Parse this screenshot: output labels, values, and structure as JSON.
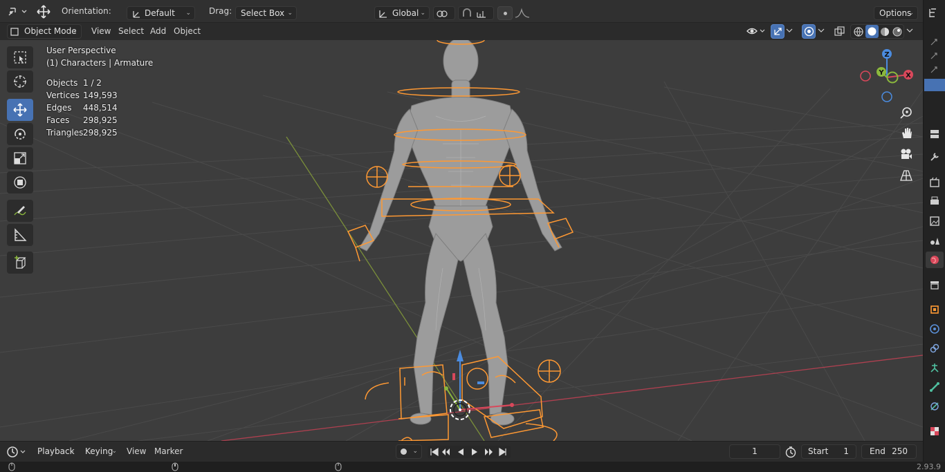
{
  "header": {
    "orientation_label": "Orientation:",
    "orientation_value": "Default",
    "drag_label": "Drag:",
    "drag_value": "Select Box",
    "transform_space": "Global",
    "options_label": "Options"
  },
  "viewport_header": {
    "mode": "Object Mode",
    "menus": [
      "View",
      "Select",
      "Add",
      "Object"
    ]
  },
  "overlay": {
    "perspective": "User Perspective",
    "collection": "(1) Characters | Armature",
    "stats": [
      {
        "label": "Objects",
        "value": "1 / 2"
      },
      {
        "label": "Vertices",
        "value": "149,593"
      },
      {
        "label": "Edges",
        "value": "448,514"
      },
      {
        "label": "Faces",
        "value": "298,925"
      },
      {
        "label": "Triangles",
        "value": "298,925"
      }
    ]
  },
  "gizmo": {
    "z": "Z",
    "y": "Y",
    "x": "X"
  },
  "timeline": {
    "menus": [
      "Playback",
      "Keying",
      "View",
      "Marker"
    ],
    "current_frame": "1",
    "start_label": "Start",
    "start_value": "1",
    "end_label": "End",
    "end_value": "250"
  },
  "status": {
    "version": "2.93.9"
  },
  "colors": {
    "accent": "#4772b3",
    "armature": "#ff9933",
    "x_axis": "#d9485b",
    "y_axis": "#8bb83d",
    "z_axis": "#4b8ce0"
  }
}
